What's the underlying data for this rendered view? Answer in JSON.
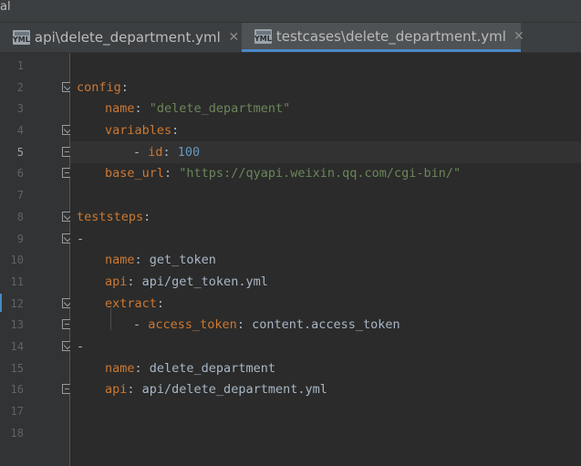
{
  "window": {
    "title_fragment": "al"
  },
  "tabs": [
    {
      "label": "api\\delete_department.yml",
      "icon": "yml-file-icon",
      "active": false,
      "close": "✕"
    },
    {
      "label": "testcases\\delete_department.yml",
      "icon": "yml-file-icon",
      "active": true,
      "close": "✕"
    }
  ],
  "editor": {
    "current_line": 5,
    "lines": [
      {
        "num": "1",
        "fold": ""
      },
      {
        "num": "2",
        "fold": "open"
      },
      {
        "num": "3",
        "fold": ""
      },
      {
        "num": "4",
        "fold": "open"
      },
      {
        "num": "5",
        "fold": "close"
      },
      {
        "num": "6",
        "fold": "close"
      },
      {
        "num": "7",
        "fold": ""
      },
      {
        "num": "8",
        "fold": "open"
      },
      {
        "num": "9",
        "fold": "open"
      },
      {
        "num": "10",
        "fold": ""
      },
      {
        "num": "11",
        "fold": ""
      },
      {
        "num": "12",
        "fold": "open"
      },
      {
        "num": "13",
        "fold": "close"
      },
      {
        "num": "14",
        "fold": "open"
      },
      {
        "num": "15",
        "fold": ""
      },
      {
        "num": "16",
        "fold": "close"
      },
      {
        "num": "17",
        "fold": ""
      },
      {
        "num": "18",
        "fold": ""
      }
    ],
    "code": {
      "l2_key": "config",
      "l2_colon": ":",
      "l3_key": "name",
      "l3_colon": ": ",
      "l3_val": "\"delete_department\"",
      "l4_key": "variables",
      "l4_colon": ":",
      "l5_dash": "- ",
      "l5_key": "id",
      "l5_colon": ": ",
      "l5_val": "100",
      "l6_key": "base_url",
      "l6_colon": ": ",
      "l6_val": "\"https://qyapi.weixin.qq.com/cgi-bin/\"",
      "l8_key": "teststeps",
      "l8_colon": ":",
      "l9_dash": "-",
      "l10_key": "name",
      "l10_colon": ": ",
      "l10_val": "get_token",
      "l11_key": "api",
      "l11_colon": ": ",
      "l11_val": "api/get_token.yml",
      "l12_key": "extract",
      "l12_colon": ":",
      "l13_dash": "- ",
      "l13_key": "access_token",
      "l13_colon": ": ",
      "l13_val": "content.access_token",
      "l14_dash": "-",
      "l15_key": "name",
      "l15_colon": ": ",
      "l15_val": "delete_department",
      "l16_key": "api",
      "l16_colon": ": ",
      "l16_val": "api/delete_department.yml"
    }
  },
  "colors": {
    "background": "#2b2b2b",
    "keyword": "#cc7832",
    "string": "#6a8759",
    "number": "#6897bb",
    "text": "#a9b7c6",
    "active_tab_underline": "#4a88c7"
  }
}
